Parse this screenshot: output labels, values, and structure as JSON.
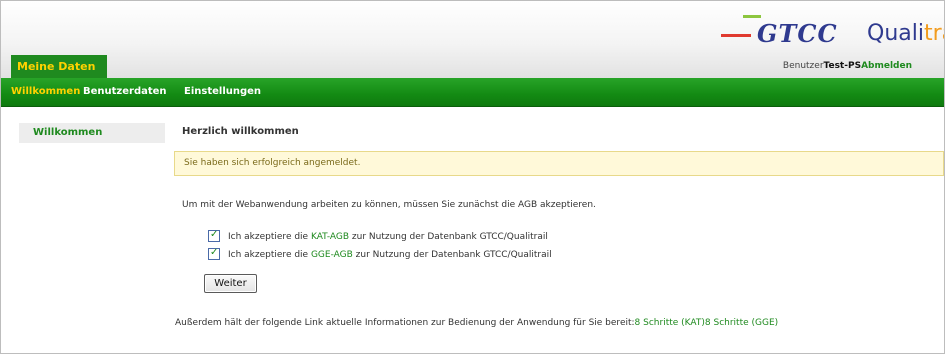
{
  "header": {
    "logo_gtcc": "GTCC",
    "logo_quali_main": "Quali",
    "logo_quali_tail": "trai",
    "main_tab": "Meine Daten",
    "user_prefix": "Benutzer",
    "user_name": "Test-PS",
    "logout": "Abmelden"
  },
  "nav": {
    "items": [
      "Willkommen",
      "Benutzerdaten",
      "Einstellungen"
    ]
  },
  "sidebar": {
    "items": [
      "Willkommen"
    ]
  },
  "main": {
    "title": "Herzlich willkommen",
    "alert": "Sie haben sich erfolgreich angemeldet.",
    "intro": "Um mit der Webanwendung arbeiten zu können, müssen Sie zunächst die AGB akzeptieren.",
    "checkbox1": {
      "prefix": "Ich akzeptiere die ",
      "link": "KAT-AGB",
      "suffix": " zur Nutzung der Datenbank GTCC/Qualitrail",
      "checked": true
    },
    "checkbox2": {
      "prefix": "Ich akzeptiere die ",
      "link": "GGE-AGB",
      "suffix": " zur Nutzung der Datenbank GTCC/Qualitrail",
      "checked": true
    },
    "button": "Weiter",
    "footer_text": "Außerdem hält der folgende Link aktuelle Informationen zur Bedienung der Anwendung für Sie bereit:",
    "footer_link1": "8 Schritte (KAT)",
    "footer_link2": "8 Schritte (GGE)"
  },
  "colors": {
    "brand_green": "#1f8a1f",
    "accent_yellow": "#ffd200",
    "logo_blue": "#2f3a8f",
    "logo_red": "#e03a2f"
  }
}
